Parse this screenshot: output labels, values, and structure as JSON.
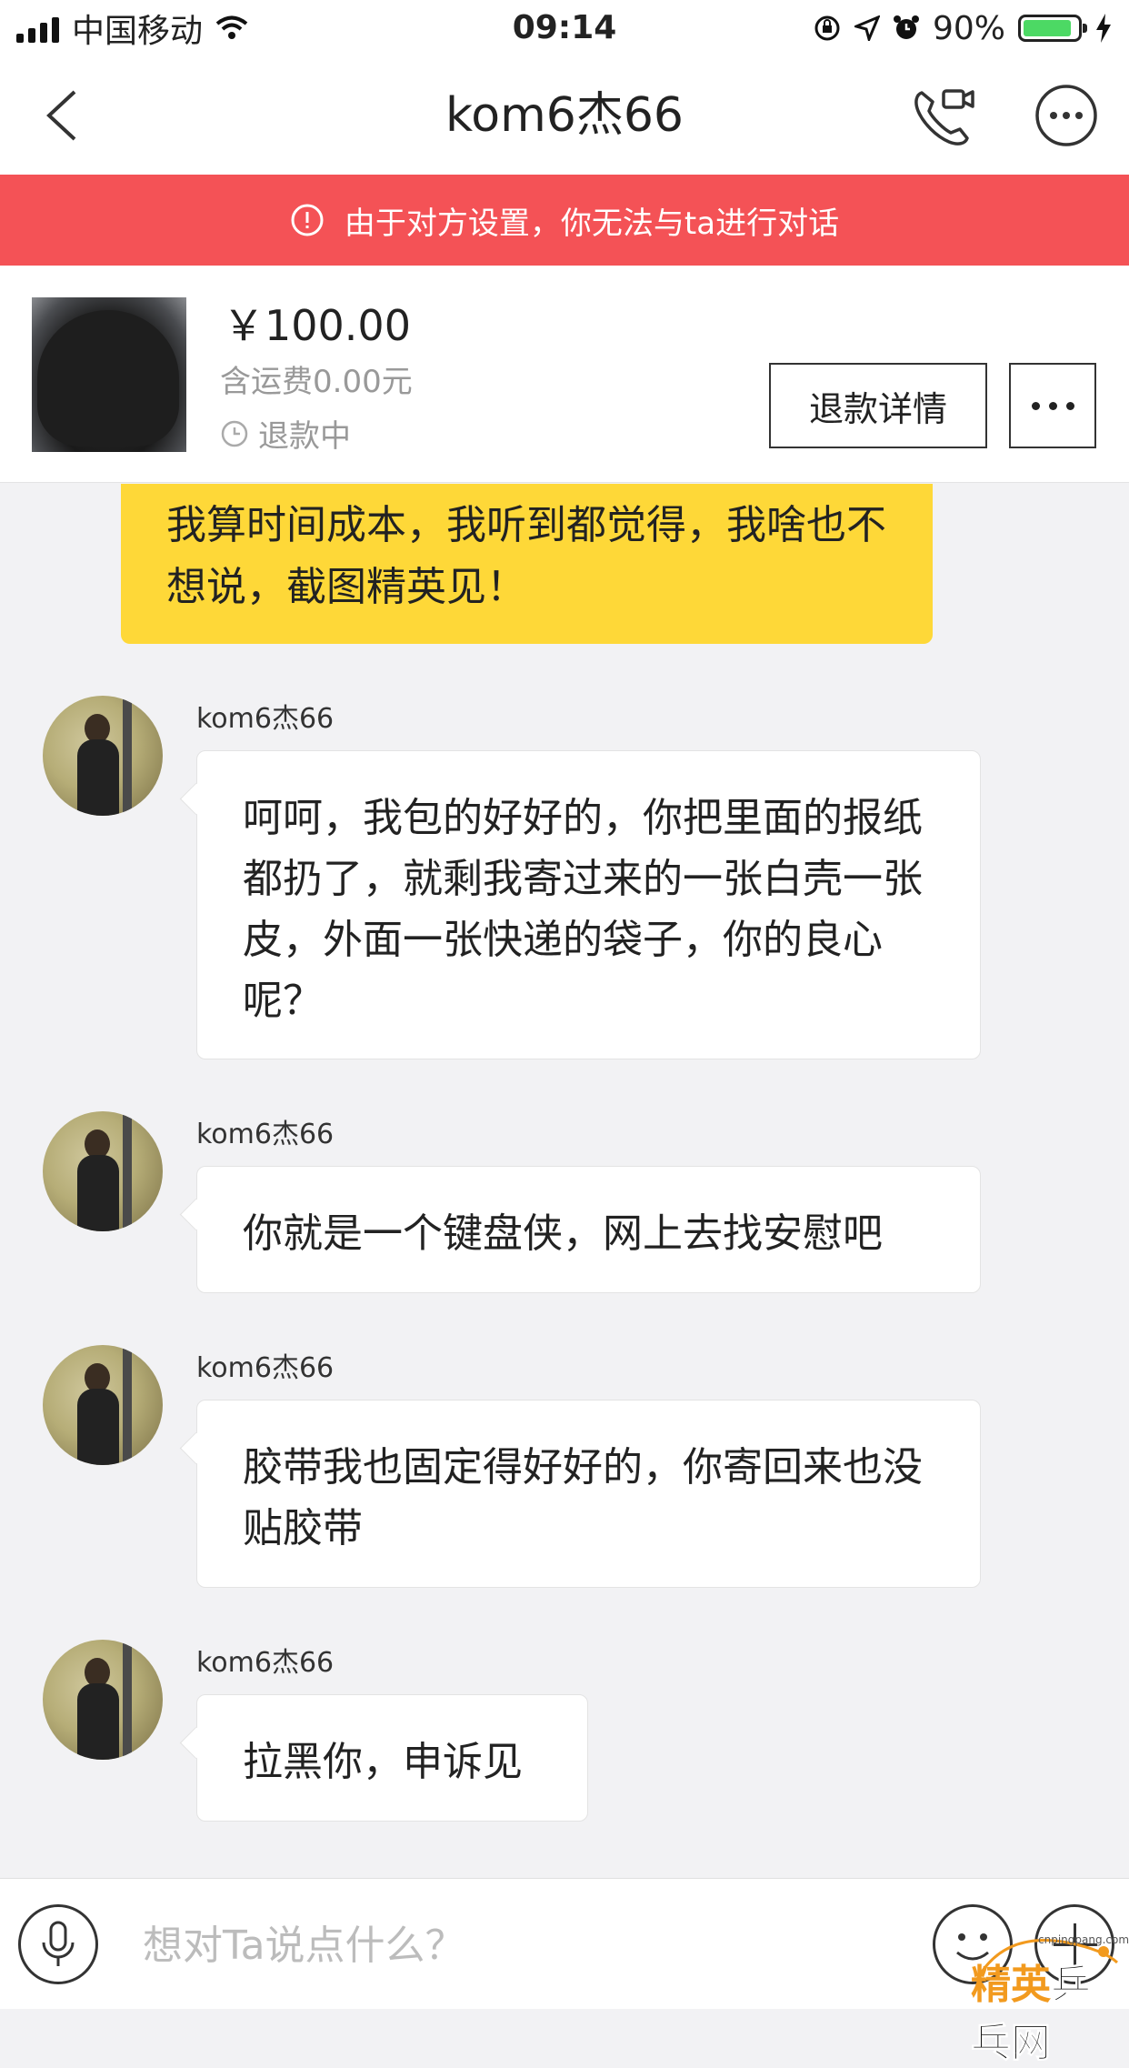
{
  "status_bar": {
    "carrier": "中国移动",
    "time": "09:14",
    "battery_percent": "90%",
    "battery_level": 0.9,
    "battery_color": "#4cd964"
  },
  "nav": {
    "title": "kom6杰66",
    "back_icon": "chevron-left-icon",
    "call_icon": "phone-video-icon",
    "more_icon": "more-circle-icon"
  },
  "banner": {
    "text": "由于对方设置，你无法与ta进行对话",
    "color": "#f45256"
  },
  "order": {
    "price": "￥100.00",
    "shipping": "含运费0.00元",
    "status": "退款中",
    "refund_button": "退款详情"
  },
  "my_message": {
    "text": "我算时间成本，我听到都觉得，我啥也不想说，截图精英见！",
    "bubble_color": "#fed838"
  },
  "messages": [
    {
      "sender": "kom6杰66",
      "text": "呵呵，我包的好好的，你把里面的报纸都扔了，就剩我寄过来的一张白壳一张皮，外面一张快递的袋子，你的良心呢？"
    },
    {
      "sender": "kom6杰66",
      "text": "你就是一个键盘侠，网上去找安慰吧"
    },
    {
      "sender": "kom6杰66",
      "text": "胶带我也固定得好好的，你寄回来也没贴胶带"
    },
    {
      "sender": "kom6杰66",
      "text": "拉黑你，申诉见"
    }
  ],
  "input": {
    "placeholder": "想对Ta说点什么？",
    "value": ""
  },
  "watermark": {
    "text_orange": "精英",
    "text_dark": "乒乓网",
    "url": "cnpingpang.com"
  }
}
